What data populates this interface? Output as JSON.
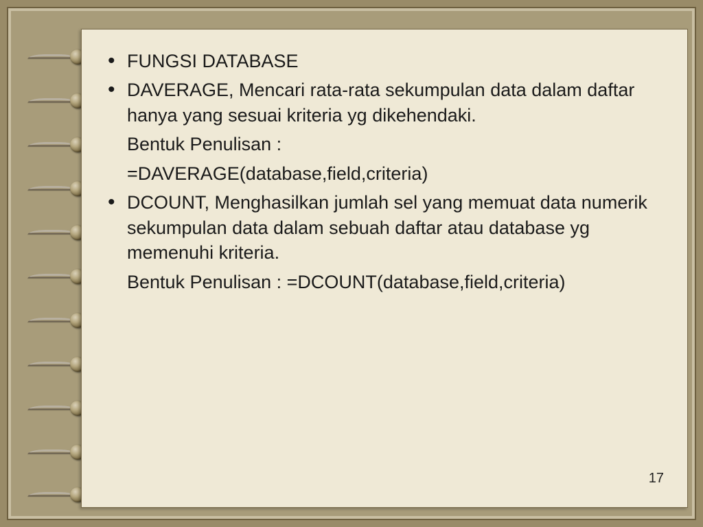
{
  "slide": {
    "bullets": [
      {
        "text": "FUNGSI DATABASE",
        "bulleted": true
      },
      {
        "text": "DAVERAGE, Mencari rata-rata sekumpulan data dalam daftar hanya yang sesuai kriteria yg dikehendaki.",
        "bulleted": true
      },
      {
        "text": "Bentuk Penulisan :",
        "bulleted": false
      },
      {
        "text": "=DAVERAGE(database,field,criteria)",
        "bulleted": false
      },
      {
        "text": "DCOUNT, Menghasilkan jumlah sel yang memuat data numerik sekumpulan data dalam sebuah daftar atau database yg memenuhi kriteria.",
        "bulleted": true
      },
      {
        "text": "Bentuk Penulisan : =DCOUNT(database,field,criteria)",
        "bulleted": false
      }
    ],
    "page_number": "17"
  }
}
